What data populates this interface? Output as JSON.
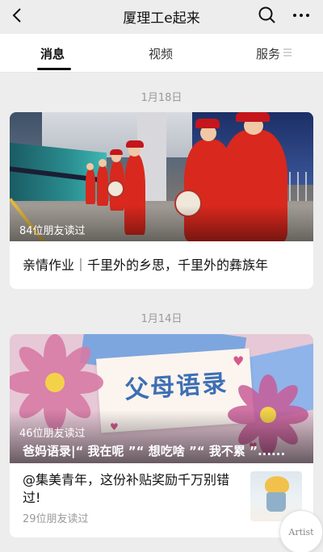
{
  "header": {
    "title": "厦理工e起来",
    "back_icon": "back-chevron-icon",
    "search_icon": "search-icon",
    "more_icon": "more-dots-icon"
  },
  "tabs": [
    {
      "label": "消息",
      "active": true
    },
    {
      "label": "视频",
      "active": false
    },
    {
      "label": "服务",
      "active": false
    }
  ],
  "feed": [
    {
      "date": "1月18日",
      "reads": "84位朋友读过",
      "title": "亲情作业｜千里外的乡思，千里外的彝族年"
    },
    {
      "date": "1月14日",
      "main": {
        "reads": "46位朋友读过",
        "title": "爸妈语录|“ 我在呢 ”“ 想吃啥 ”“ 我不累 ”......",
        "image_text": "父母语录"
      },
      "sub": {
        "title": "@集美青年，这份补贴奖励千万别错过!",
        "reads": "29位朋友读过"
      }
    }
  ],
  "floating": {
    "label": "Artist"
  },
  "colors": {
    "background": "#ededed",
    "card": "#ffffff",
    "muted": "#9a9a9a"
  }
}
